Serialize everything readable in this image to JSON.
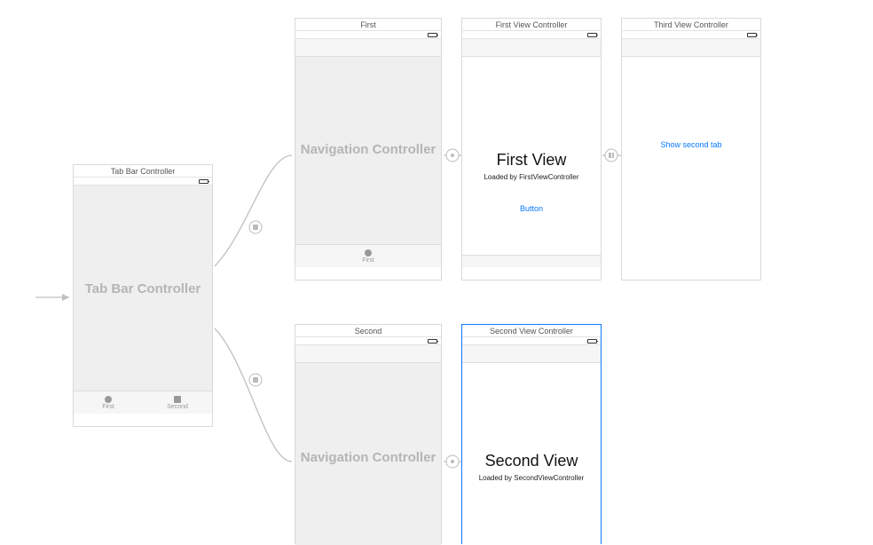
{
  "tabbar_controller": {
    "title": "Tab Bar Controller",
    "body_label": "Tab Bar Controller",
    "tabs": [
      {
        "label": "First",
        "icon": "circle"
      },
      {
        "label": "Second",
        "icon": "square"
      }
    ]
  },
  "nav_first": {
    "title": "First",
    "body_label": "Navigation Controller",
    "tab_label": "First"
  },
  "nav_second": {
    "title": "Second",
    "body_label": "Navigation Controller"
  },
  "first_vc": {
    "title": "First View Controller",
    "heading": "First View",
    "subheading": "Loaded by FirstViewController",
    "button_label": "Button"
  },
  "second_vc": {
    "title": "Second View Controller",
    "heading": "Second View",
    "subheading": "Loaded by SecondViewController"
  },
  "third_vc": {
    "title": "Third View Controller",
    "button_label": "Show second tab"
  }
}
